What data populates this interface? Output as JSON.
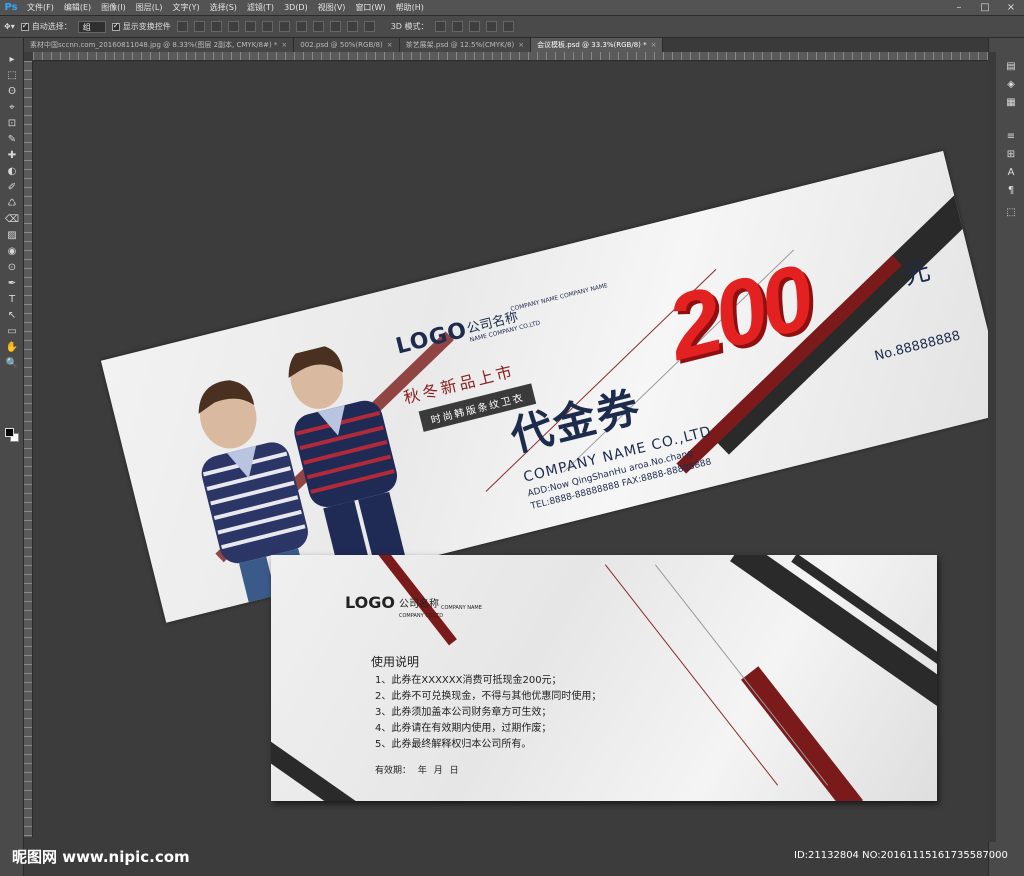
{
  "app": {
    "logo_text": "Ps"
  },
  "menu": [
    "文件(F)",
    "编辑(E)",
    "图像(I)",
    "图层(L)",
    "文字(Y)",
    "选择(S)",
    "滤镜(T)",
    "3D(D)",
    "视图(V)",
    "窗口(W)",
    "帮助(H)"
  ],
  "window_controls": [
    "–",
    "□",
    "×"
  ],
  "options": {
    "auto_select_label": "自动选择：",
    "auto_select_value": "组",
    "show_transform_label": "显示变换控件",
    "mode_3d_label": "3D 模式："
  },
  "tabs": [
    {
      "label": "素材中国sccnn.com_20160811048.jpg @ 8.33%(图层 2副本, CMYK/8#) *",
      "active": false
    },
    {
      "label": "002.psd @ 50%(RGB/8)",
      "active": false
    },
    {
      "label": "茶艺展架.psd @ 12.5%(CMYK/8)",
      "active": false
    },
    {
      "label": "会议模板.psd @ 33.3%(RGB/8) *",
      "active": true
    }
  ],
  "tools": [
    "▸",
    "⬚",
    "ʘ",
    "⌖",
    "⊡",
    "✎",
    "✚",
    "◐",
    "✐",
    "♺",
    "⌫",
    "▨",
    "◉",
    "⊙",
    "✒",
    "T",
    "↖",
    "▭",
    "✋",
    "🔍"
  ],
  "voucher_front": {
    "logo": "LOGO",
    "company_cn": "公司名称",
    "company_en_1": "COMPANY NAME COMPANY NAME",
    "company_en_2": "NAME COMPANY CO.LTD",
    "slogan": "秋冬新品上市",
    "sub_slogan": "时尚韩版条纹卫衣",
    "title": "代金券",
    "amount": "200",
    "unit": "元",
    "serial": "No.88888888",
    "company_name": "COMPANY NAME CO.,LTD",
    "address": "ADD:Now QingShanHu aroa.No.chang",
    "tel": "TEL:8888-88888888   FAX:8888-88888888"
  },
  "voucher_back": {
    "logo": "LOGO",
    "company_cn": "公司名称",
    "company_en_1": "COMPANY NAME",
    "company_en_2": "COMPANY CO.LTD",
    "usage_title": "使用说明",
    "rules": [
      "1、此券在XXXXXX消费可抵现金200元；",
      "2、此券不可兑换现金，不得与其他优惠同时使用；",
      "3、此券须加盖本公司财务章方可生效；",
      "4、此券请在有效期内使用，过期作废；",
      "5、此券最终解释权归本公司所有。"
    ],
    "validity": "有效期：      年   月   日"
  },
  "watermark": "昵图网 www.nipic.com",
  "image_id": "ID:21132804 NO:20161115161735587000",
  "colors": {
    "accent_red": "#e42121",
    "navy": "#1d2b4d",
    "dark_red": "#8a1e1e"
  }
}
